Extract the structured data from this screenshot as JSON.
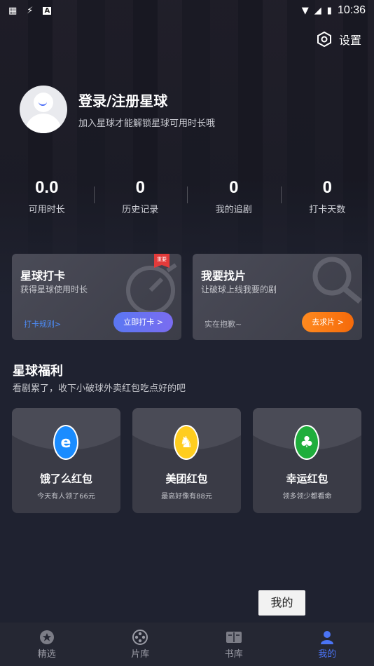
{
  "status": {
    "time": "10:36",
    "icons": [
      "grid-icon",
      "bolt-icon",
      "a-icon",
      "wifi-icon",
      "signal-icon",
      "battery-icon"
    ]
  },
  "settings": {
    "label": "设置"
  },
  "profile": {
    "title": "登录/注册星球",
    "subtitle": "加入星球才能解锁星球可用时长哦"
  },
  "stats": [
    {
      "value": "0.0",
      "label": "可用时长"
    },
    {
      "value": "0",
      "label": "历史记录"
    },
    {
      "value": "0",
      "label": "我的追剧"
    },
    {
      "value": "0",
      "label": "打卡天数"
    }
  ],
  "cards": {
    "checkin": {
      "title": "星球打卡",
      "subtitle": "获得星球使用时长",
      "link": "打卡规则>",
      "button": "立即打卡 >",
      "tag": "重要"
    },
    "find": {
      "title": "我要找片",
      "subtitle": "让破球上线我要的剧",
      "note": "实在抱歉~",
      "button": "去求片 >"
    }
  },
  "welfare": {
    "title": "星球福利",
    "subtitle": "看剧累了，收下小破球外卖红包吃点好的吧",
    "items": [
      {
        "title": "饿了么红包",
        "subtitle": "今天有人领了66元",
        "color": "#1a8cff"
      },
      {
        "title": "美团红包",
        "subtitle": "最高好像有88元",
        "color": "#ffcd1f"
      },
      {
        "title": "幸运红包",
        "subtitle": "领多领少都看命",
        "color": "#1fae3c"
      }
    ]
  },
  "tooltip": "我的",
  "nav": [
    {
      "label": "精选",
      "icon": "star-icon"
    },
    {
      "label": "片库",
      "icon": "film-reel-icon"
    },
    {
      "label": "书库",
      "icon": "book-icon"
    },
    {
      "label": "我的",
      "icon": "user-icon",
      "active": true
    }
  ],
  "colors": {
    "accent": "#4b74f5",
    "orange": "#f57a14",
    "link": "#4d8bf5"
  }
}
